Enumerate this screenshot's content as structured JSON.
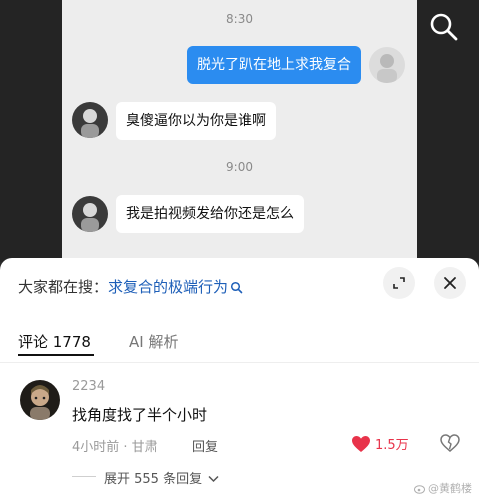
{
  "video": {
    "chat": {
      "time1": "8:30",
      "msg1": "脱光了趴在地上求我复合",
      "msg2": "臭傻逼你以为你是谁啊",
      "time2": "9:00",
      "msg3": "我是拍视频发给你还是怎么"
    },
    "search_icon": "search-icon"
  },
  "sheet": {
    "suggestion_prefix": "大家都在搜：",
    "suggestion_query": "求复合的极端行为",
    "tabs": [
      {
        "label": "评论 1778"
      },
      {
        "label": "AI 解析"
      }
    ],
    "comment": {
      "username": "2234",
      "text": "找角度找了半个小时",
      "meta": "4小时前 · 甘肃",
      "reply": "回复",
      "likes": "1.5万",
      "expand": "展开 555 条回复"
    },
    "watermark": "@黄鹤楼"
  },
  "colors": {
    "accent_blue": "#2b8cf0",
    "query_blue": "#1e5fb8",
    "like_red": "#e8334a"
  }
}
